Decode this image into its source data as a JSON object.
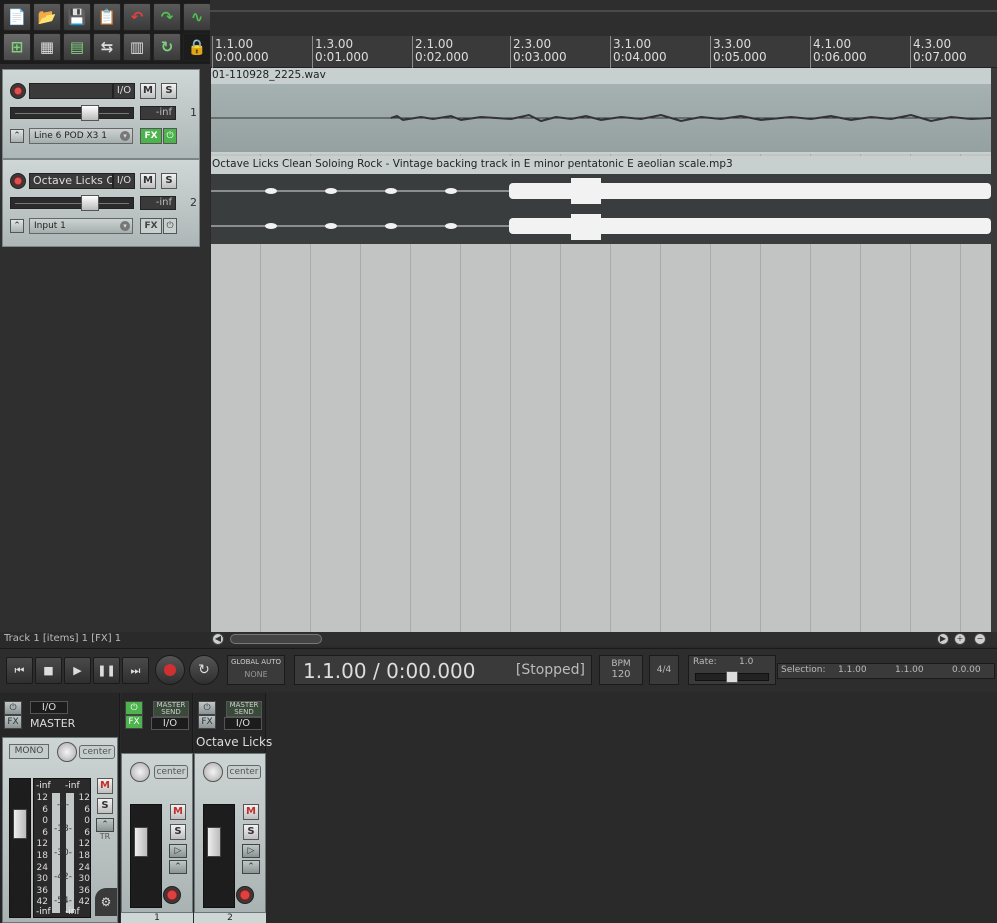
{
  "toolbar": {
    "buttons": [
      "new-project",
      "open-project",
      "save-project",
      "project-settings",
      "undo",
      "redo",
      "metronome",
      "snap",
      "grid",
      "item-grouping",
      "ripple-edit",
      "loop",
      "envelope-lock"
    ]
  },
  "ruler": {
    "marks": [
      {
        "bar": "1.1.00",
        "time": "0:00.000"
      },
      {
        "bar": "1.3.00",
        "time": "0:01.000"
      },
      {
        "bar": "2.1.00",
        "time": "0:02.000"
      },
      {
        "bar": "2.3.00",
        "time": "0:03.000"
      },
      {
        "bar": "3.1.00",
        "time": "0:04.000"
      },
      {
        "bar": "3.3.00",
        "time": "0:05.000"
      },
      {
        "bar": "4.1.00",
        "time": "0:06.000"
      },
      {
        "bar": "4.3.00",
        "time": "0:07.000"
      }
    ]
  },
  "tracks": [
    {
      "number": "1",
      "name": "",
      "io": "I/O",
      "mute": "M",
      "solo": "S",
      "volume": "-inf",
      "input": "Line 6 POD X3 1",
      "fx": "FX",
      "fx_active": true
    },
    {
      "number": "2",
      "name": "Octave Licks Cle",
      "io": "I/O",
      "mute": "M",
      "solo": "S",
      "volume": "-inf",
      "input": "Input 1",
      "fx": "FX",
      "fx_active": false
    }
  ],
  "items": [
    {
      "title": "01-110928_2225.wav"
    },
    {
      "title": "Octave Licks Clean Soloing Rock - Vintage backing track in E minor pentatonic E aeolian scale.mp3"
    }
  ],
  "status": "Track 1 [items] 1 [FX] 1",
  "transport": {
    "time": "1.1.00 / 0:00.000",
    "state": "[Stopped]",
    "global_auto_label": "GLOBAL AUTO",
    "global_auto_value": "NONE",
    "bpm_label": "BPM",
    "bpm": "120",
    "timesig": "4/4",
    "rate_label": "Rate:",
    "rate": "1.0",
    "selection_label": "Selection:",
    "selection_start": "1.1.00",
    "selection_end": "1.1.00",
    "selection_length": "0.0.00"
  },
  "mixer": {
    "master": {
      "io": "I/O",
      "name": "MASTER",
      "fx": "FX",
      "mono": "MONO",
      "pan": "center",
      "mute": "M",
      "solo": "S",
      "tr": "TR",
      "peak_l": "-inf",
      "peak_r": "-inf",
      "scale_left": [
        "12",
        "6",
        "0",
        "6",
        "12",
        "18",
        "24",
        "30",
        "36",
        "42"
      ],
      "scale_mid": [
        "-6-",
        "-18-",
        "-30-",
        "-42-",
        "-54-"
      ],
      "scale_right": [
        "12",
        "6",
        "0",
        "6",
        "12",
        "18",
        "24",
        "30",
        "36",
        "42"
      ],
      "bottom_l": "-inf",
      "bottom_r": "-inf"
    },
    "strips": [
      {
        "number": "1",
        "name": "",
        "master_send": "MASTER\nSEND",
        "io": "I/O",
        "fx": "FX",
        "fx_active": true,
        "pan": "center",
        "mute": "M",
        "solo": "S"
      },
      {
        "number": "2",
        "name": "Octave Licks",
        "master_send": "MASTER\nSEND",
        "io": "I/O",
        "fx": "FX",
        "fx_active": false,
        "pan": "center",
        "mute": "M",
        "solo": "S"
      }
    ]
  },
  "colors": {
    "fx_active": "#4db34d",
    "record_arm": "#d03030",
    "item_bg": "#9aa5a5",
    "waveform": "#f2f2f2"
  }
}
